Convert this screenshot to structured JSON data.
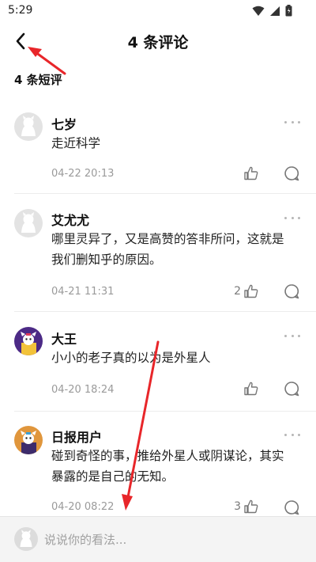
{
  "status_bar": {
    "time": "5:29"
  },
  "header": {
    "title": "4 条评论"
  },
  "section": {
    "title": "4 条短评"
  },
  "comments": [
    {
      "name": "七岁",
      "text": "走近科学",
      "time": "04-22 20:13",
      "likes": "",
      "avatar": "default-avatar-icon"
    },
    {
      "name": "艾尤尤",
      "text": "哪里灵异了，又是高赞的答非所问，这就是我们删知乎的原因。",
      "time": "04-21 11:31",
      "likes": "2",
      "avatar": "default-avatar-icon"
    },
    {
      "name": "大王",
      "text": "小小的老子真的以为是外星人",
      "time": "04-20 18:24",
      "likes": "",
      "avatar": "purple-character-avatar-icon"
    },
    {
      "name": "日报用户",
      "text": "碰到奇怪的事，推给外星人或阴谋论，其实暴露的是自己的无知。",
      "time": "04-20 08:22",
      "likes": "3",
      "avatar": "orange-character-avatar-icon"
    }
  ],
  "input": {
    "placeholder": "说说你的看法..."
  },
  "colors": {
    "annotation_arrow": "#e8262a",
    "secondary_text": "#9a9a9a",
    "divider": "#ececec"
  }
}
